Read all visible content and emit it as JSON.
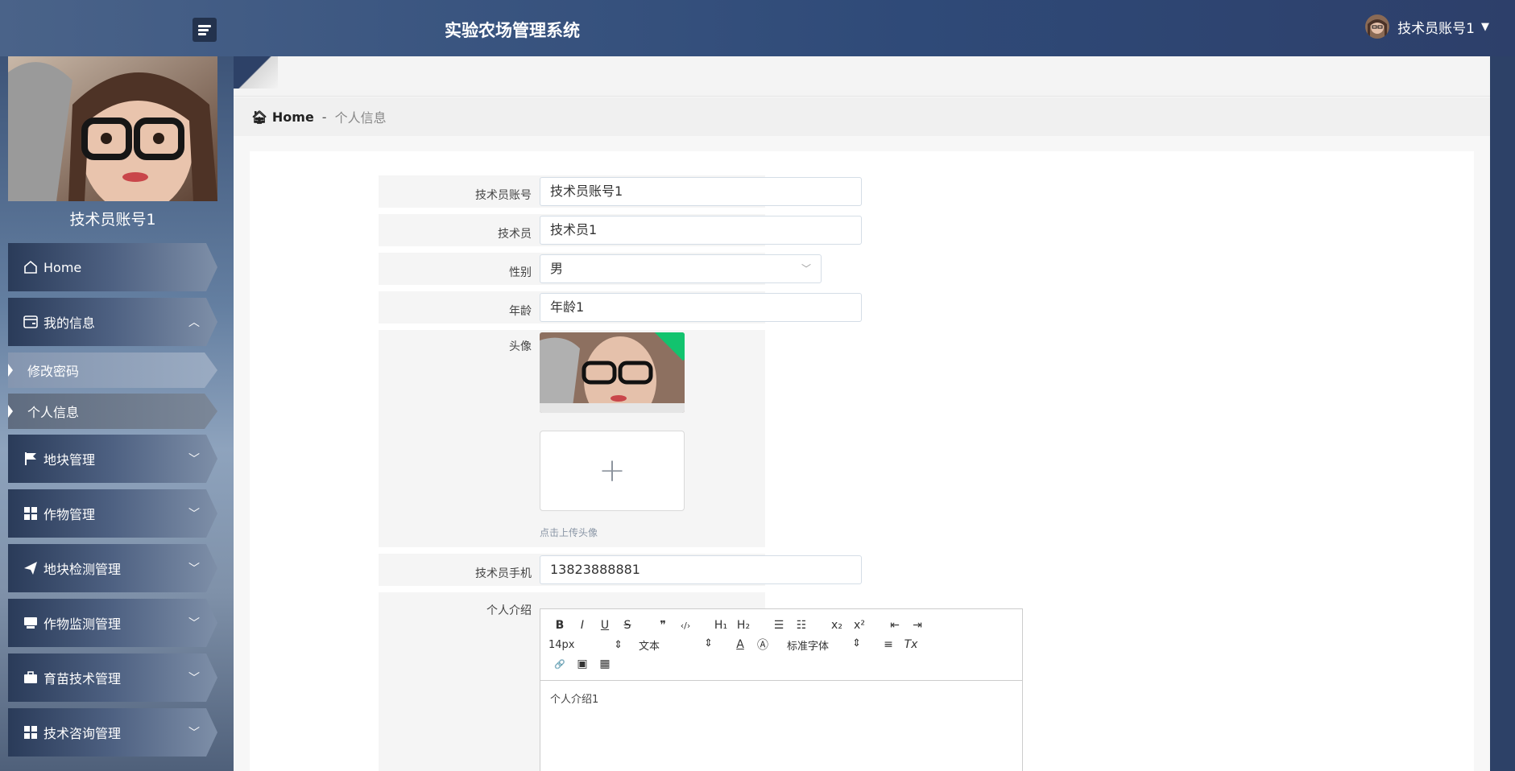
{
  "header": {
    "title": "实验农场管理系统",
    "username": "技术员账号1"
  },
  "sidebar": {
    "profile_name": "技术员账号1",
    "items": [
      {
        "label": "Home",
        "icon": "home-icon"
      },
      {
        "label": "我的信息",
        "icon": "card-icon"
      },
      {
        "label": "地块管理",
        "icon": "flag-icon"
      },
      {
        "label": "作物管理",
        "icon": "grid-icon"
      },
      {
        "label": "地块检测管理",
        "icon": "send-icon"
      },
      {
        "label": "作物监测管理",
        "icon": "monitor-icon"
      },
      {
        "label": "育苗技术管理",
        "icon": "briefcase-icon"
      },
      {
        "label": "技术咨询管理",
        "icon": "grid-icon"
      }
    ],
    "subitems": [
      {
        "label": "修改密码"
      },
      {
        "label": "个人信息"
      }
    ]
  },
  "breadcrumb": {
    "home": "Home",
    "separator": "-",
    "current": "个人信息"
  },
  "form": {
    "account_label": "技术员账号",
    "account_value": "技术员账号1",
    "name_label": "技术员",
    "name_value": "技术员1",
    "gender_label": "性别",
    "gender_value": "男",
    "age_label": "年龄",
    "age_value": "年龄1",
    "avatar_label": "头像",
    "upload_hint": "点击上传头像",
    "upload_plus": "+",
    "phone_label": "技术员手机",
    "phone_value": "13823888881",
    "intro_label": "个人介绍",
    "intro_value": "个人介绍1"
  },
  "editor": {
    "font_size": "14px",
    "block_type": "文本",
    "font_family": "标准字体",
    "buttons": {
      "bold": "B",
      "italic": "I",
      "underline": "U",
      "strike": "S",
      "quote": "❞",
      "code": "‹/›",
      "h1": "H₁",
      "h2": "H₂",
      "ol": "☰",
      "ul": "☷",
      "sub": "x₂",
      "sup": "x²",
      "outdent": "⇤",
      "indent": "⇥",
      "color": "A",
      "bg": "Ⓐ",
      "align": "≡",
      "clear": "Tx",
      "link": "🔗",
      "image": "▣",
      "video": "▦"
    }
  },
  "colors": {
    "header_bg": "#2f4a78",
    "badge_green": "#12c36e"
  }
}
